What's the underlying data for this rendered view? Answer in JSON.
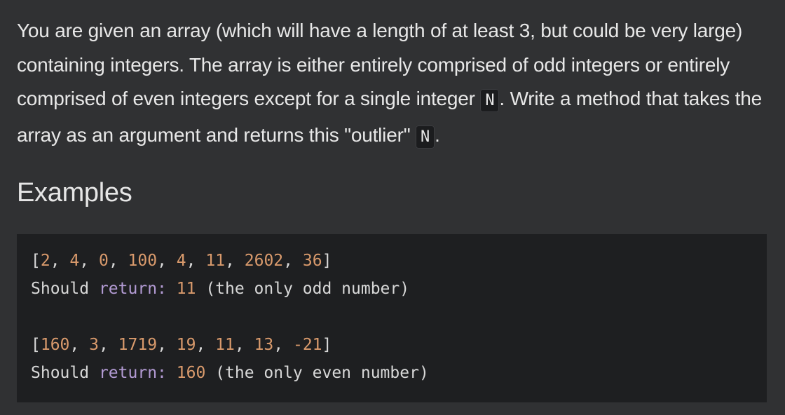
{
  "description": {
    "part1": "You are given an array (which will have a length of at least 3, but could be very large) containing integers. The array is either entirely comprised of odd integers or entirely comprised of even integers except for a single integer ",
    "code1": "N",
    "part2": ". Write a method that takes the array as an argument and returns this \"outlier\" ",
    "code2": "N",
    "part3": "."
  },
  "examples_heading": "Examples",
  "code_example": {
    "example1": {
      "open_bracket": "[",
      "values": [
        "2",
        "4",
        "0",
        "100",
        "4",
        "11",
        "2602",
        "36"
      ],
      "close_bracket": "]",
      "should": "Should",
      "return_kw": "return:",
      "result": "11",
      "comment": "(the only odd number)"
    },
    "example2": {
      "open_bracket": "[",
      "values": [
        "160",
        "3",
        "1719",
        "19",
        "11",
        "13",
        "-21"
      ],
      "close_bracket": "]",
      "should": "Should",
      "return_kw": "return:",
      "result": "160",
      "comment": "(the only even number)"
    }
  },
  "colors": {
    "background": "#303133",
    "code_background": "#1e1f21",
    "number": "#d99a6c",
    "keyword": "#b39bd4",
    "text": "#e8e8e8"
  }
}
